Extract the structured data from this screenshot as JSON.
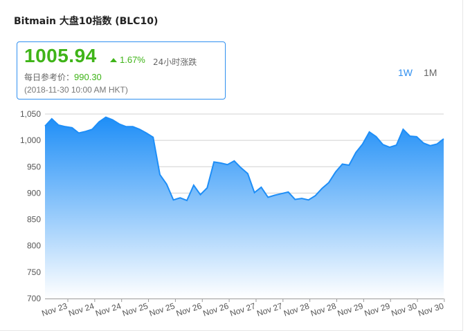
{
  "header": {
    "title": "Bitmain 大盘10指数 (BLC10)"
  },
  "info": {
    "price": "1005.94",
    "change_pct": "1.67%",
    "change_label": "24小时涨跌",
    "ref_label": "每日参考价：",
    "ref_value": "990.30",
    "timestamp": "(2018-11-30 10:00 AM HKT)"
  },
  "range_buttons": {
    "week": "1W",
    "month": "1M"
  },
  "colors": {
    "up": "#3fb418",
    "accent": "#2f8ff0",
    "area_top": "#1e8ef7",
    "area_bottom": "#ffffff"
  },
  "chart_data": {
    "type": "area",
    "title": "",
    "xlabel": "",
    "ylabel": "",
    "ylim": [
      700,
      1050
    ],
    "yticks": [
      700,
      750,
      800,
      850,
      900,
      950,
      1000,
      1050
    ],
    "grid": true,
    "xtick_labels": [
      "Nov 23",
      "Nov 24",
      "Nov 24",
      "Nov 25",
      "Nov 25",
      "Nov 26",
      "Nov 26",
      "Nov 27",
      "Nov 27",
      "Nov 28",
      "Nov 28",
      "Nov 29",
      "Nov 29",
      "Nov 30",
      "Nov 30"
    ],
    "series": [
      {
        "values": [
          1027,
          1041,
          1029,
          1026,
          1024,
          1014,
          1017,
          1021,
          1035,
          1044,
          1039,
          1031,
          1026,
          1026,
          1021,
          1014,
          1006,
          935,
          917,
          887,
          891,
          886,
          915,
          897,
          910,
          959,
          957,
          954,
          961,
          948,
          937,
          901,
          911,
          892,
          896,
          899,
          902,
          888,
          890,
          887,
          895,
          909,
          920,
          940,
          955,
          953,
          977,
          993,
          1016,
          1007,
          992,
          987,
          991,
          1021,
          1008,
          1007,
          995,
          990,
          993,
          1003
        ]
      }
    ]
  }
}
